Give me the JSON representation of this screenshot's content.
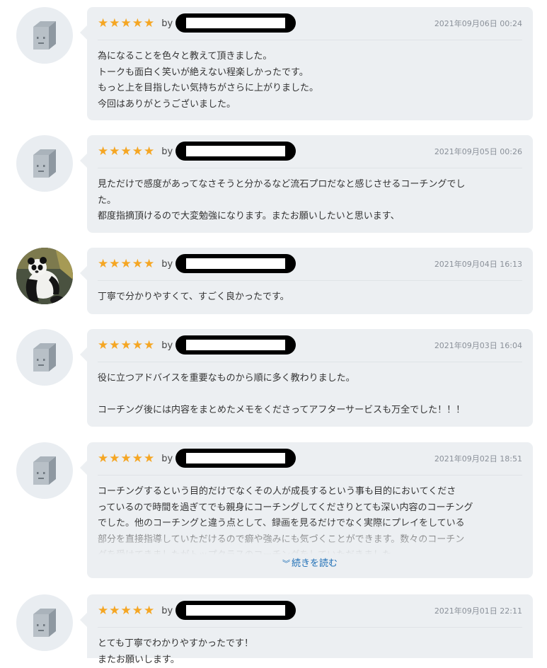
{
  "reviews": [
    {
      "rating": 5,
      "by": "by",
      "date": "2021年09月06日 00:24",
      "avatar": "default-avatar",
      "lines": [
        "為になることを色々と教えて頂きました。",
        "トークも面白く笑いが絶えない程楽しかったです。",
        "もっと上を目指したい気持ちがさらに上がりました。",
        "今回はありがとうございました。"
      ]
    },
    {
      "rating": 5,
      "by": "by",
      "date": "2021年09月05日 00:26",
      "avatar": "default-avatar",
      "lines": [
        "見ただけで感度があってなさそうと分かるなど流石プロだなと感じさせるコーチングでし",
        "た。",
        "都度指摘頂けるので大変勉強になります。またお願いしたいと思います、"
      ]
    },
    {
      "rating": 5,
      "by": "by",
      "date": "2021年09月04日 16:13",
      "avatar": "panda-photo-avatar",
      "lines": [
        "丁寧で分かりやすくて、すごく良かったです。"
      ]
    },
    {
      "rating": 5,
      "by": "by",
      "date": "2021年09月03日 16:04",
      "avatar": "default-avatar",
      "lines": [
        "役に立つアドバイスを重要なものから順に多く教わりました。",
        "",
        "コーチング後には内容をまとめたメモをくださってアフターサービスも万全でした！！！"
      ]
    },
    {
      "rating": 5,
      "by": "by",
      "date": "2021年09月02日 18:51",
      "avatar": "default-avatar",
      "lines": [
        "コーチングするという目的だけでなくその人が成長するという事も目的においてくださ",
        "っているので時間を過ぎてでも親身にコーチングしてくださりとても深い内容のコーチング",
        "でした。他のコーチングと違う点として、録画を見るだけでなく実際にプレイをしている",
        "部分を直接指導していただけるので癖や強みにも気づくことができます。数々のコーチン",
        "グを受けてきましたがトップクラスのコーチングをしていただきました。"
      ],
      "read_more": "続きを読む"
    },
    {
      "rating": 5,
      "by": "by",
      "date": "2021年09月01日 22:11",
      "avatar": "default-avatar",
      "lines": [
        "とても丁寧でわかりやすかったです！",
        "またお願いします。"
      ]
    }
  ]
}
